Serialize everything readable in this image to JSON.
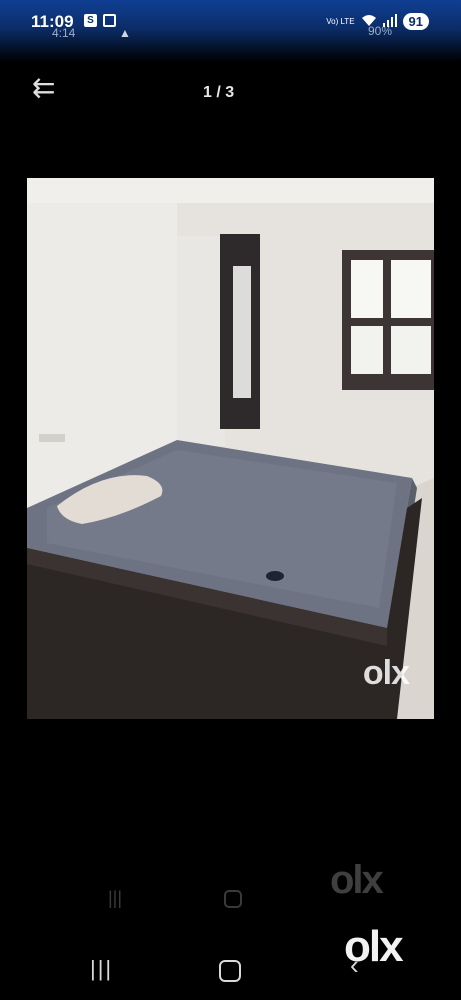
{
  "status_bar": {
    "time": "11:09",
    "ghost_time": "4:14",
    "battery": "91",
    "ghost_battery": "90%",
    "volte_label": "Vo) LTE",
    "s_icon_letter": "S"
  },
  "toolbar": {
    "back_glyph": "⇇",
    "image_counter": "1 / 3"
  },
  "photo": {
    "watermark": "OLX",
    "watermark_text": "olx"
  },
  "overlay": {
    "ghost_logo": "olx",
    "logo": "olx"
  },
  "navbar": {
    "recent_glyph": "|||",
    "back_glyph": "‹"
  },
  "colors": {
    "status_bar": "#0f3f93",
    "background": "#000000",
    "mattress": "#6d7382",
    "bed_frame": "#2c2624"
  }
}
